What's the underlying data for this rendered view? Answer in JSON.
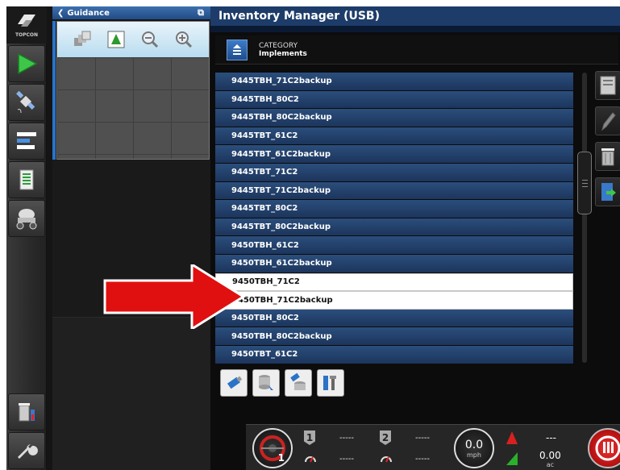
{
  "logo": {
    "brand": "TOPCON"
  },
  "guidance": {
    "title": "Guidance"
  },
  "window_title": "Inventory Manager (USB)",
  "category": {
    "label": "CATEGORY",
    "value": "Implements"
  },
  "items": [
    {
      "name": "9445TBH_71C2backup",
      "selected": false
    },
    {
      "name": "9445TBH_80C2",
      "selected": false
    },
    {
      "name": "9445TBH_80C2backup",
      "selected": false
    },
    {
      "name": "9445TBT_61C2",
      "selected": false
    },
    {
      "name": "9445TBT_61C2backup",
      "selected": false
    },
    {
      "name": "9445TBT_71C2",
      "selected": false
    },
    {
      "name": "9445TBT_71C2backup",
      "selected": false
    },
    {
      "name": "9445TBT_80C2",
      "selected": false
    },
    {
      "name": "9445TBT_80C2backup",
      "selected": false
    },
    {
      "name": "9450TBH_61C2",
      "selected": false
    },
    {
      "name": "9450TBH_61C2backup",
      "selected": false
    },
    {
      "name": "9450TBH_71C2",
      "selected": true
    },
    {
      "name": "9450TBH_71C2backup",
      "selected": true
    },
    {
      "name": "9450TBH_80C2",
      "selected": false
    },
    {
      "name": "9450TBH_80C2backup",
      "selected": false
    },
    {
      "name": "9450TBT_61C2",
      "selected": false
    }
  ],
  "status": {
    "section1": {
      "num": "1",
      "top": "-----",
      "bottom": "-----"
    },
    "section2": {
      "num": "2",
      "top": "-----",
      "bottom": "-----"
    },
    "dial1_label": "1",
    "speed": "0.0",
    "speed_unit": "mph",
    "area_top": "---",
    "area_value": "0.00",
    "area_unit": "ac"
  },
  "colors": {
    "accent": "#1d3c69",
    "row": "#2b4e7c",
    "arrow": "#e01010",
    "guidance_tab": "#214b84"
  }
}
